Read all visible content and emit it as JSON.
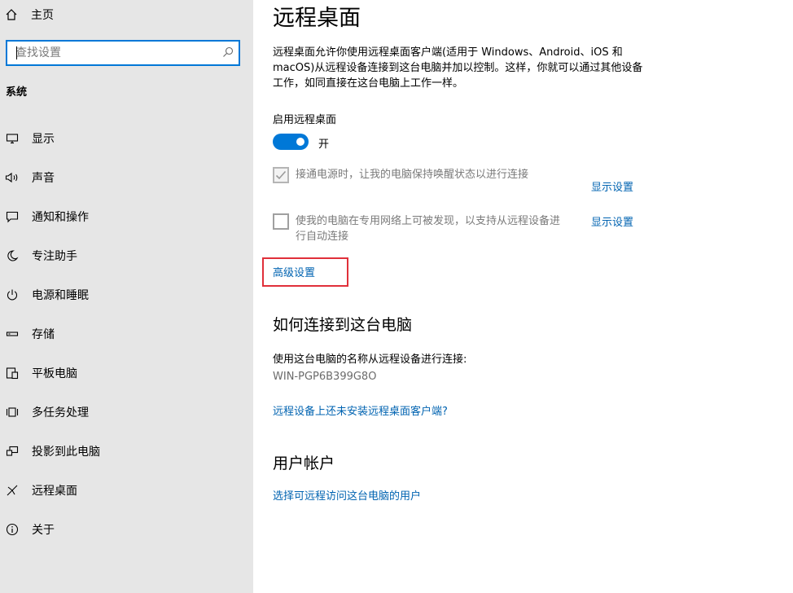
{
  "sidebar": {
    "home_label": "主页",
    "search": {
      "placeholder": "查找设置",
      "value": ""
    },
    "section_title": "系统",
    "items": [
      {
        "label": "显示",
        "icon": "monitor-icon"
      },
      {
        "label": "声音",
        "icon": "speaker-icon"
      },
      {
        "label": "通知和操作",
        "icon": "notification-icon"
      },
      {
        "label": "专注助手",
        "icon": "moon-icon"
      },
      {
        "label": "电源和睡眠",
        "icon": "power-icon"
      },
      {
        "label": "存储",
        "icon": "storage-icon"
      },
      {
        "label": "平板电脑",
        "icon": "tablet-icon"
      },
      {
        "label": "多任务处理",
        "icon": "multitask-icon"
      },
      {
        "label": "投影到此电脑",
        "icon": "project-icon"
      },
      {
        "label": "远程桌面",
        "icon": "remote-desktop-icon"
      },
      {
        "label": "关于",
        "icon": "info-icon"
      }
    ]
  },
  "main": {
    "title": "远程桌面",
    "description": "远程桌面允许你使用远程桌面客户端(适用于 Windows、Android、iOS 和 macOS)从远程设备连接到这台电脑并加以控制。这样，你就可以通过其他设备工作，如同直接在这台电脑上工作一样。",
    "enable_label": "启用远程桌面",
    "toggle_state": "开",
    "toggle_on": true,
    "checkbox1": {
      "label": "接通电源时，让我的电脑保持唤醒状态以进行连接",
      "checked": true,
      "link": "显示设置"
    },
    "checkbox2": {
      "label_line1": "使我的电脑在专用网络上可被发现，以支持从远程设备进",
      "label_line2": "行自动连接",
      "checked": false,
      "link": "显示设置"
    },
    "advanced_link": "高级设置",
    "connect_heading": "如何连接到这台电脑",
    "connect_text": "使用这台电脑的名称从远程设备进行连接:",
    "pc_name": "WIN-PGP6B399G8O",
    "client_link": "远程设备上还未安装远程桌面客户端?",
    "accounts_heading": "用户帐户",
    "accounts_link": "选择可远程访问这台电脑的用户"
  },
  "colors": {
    "accent": "#0078d7",
    "link": "#0063b1",
    "highlight": "#e0303a",
    "sidebar_bg": "#e6e6e6"
  }
}
